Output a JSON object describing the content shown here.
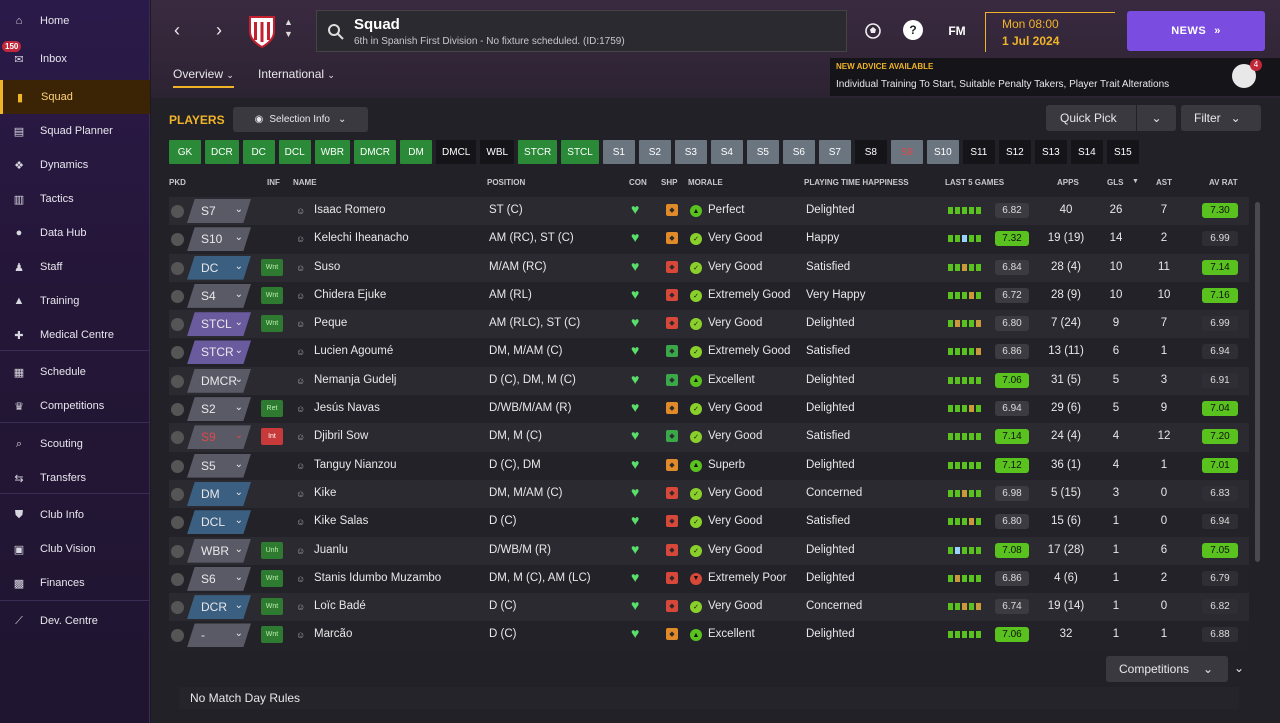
{
  "sidebar": {
    "inbox_badge": "150",
    "items": [
      {
        "label": "Home",
        "icon": "home-icon"
      },
      {
        "label": "Inbox",
        "icon": "inbox-icon"
      },
      {
        "label": "Squad",
        "icon": "squad-icon"
      },
      {
        "label": "Squad Planner",
        "icon": "clipboard-icon"
      },
      {
        "label": "Dynamics",
        "icon": "dynamics-icon"
      },
      {
        "label": "Tactics",
        "icon": "tactics-icon"
      },
      {
        "label": "Data Hub",
        "icon": "data-hub-icon"
      },
      {
        "label": "Staff",
        "icon": "staff-icon"
      },
      {
        "label": "Training",
        "icon": "training-icon"
      },
      {
        "label": "Medical Centre",
        "icon": "medical-icon"
      },
      {
        "label": "Schedule",
        "icon": "calendar-icon"
      },
      {
        "label": "Competitions",
        "icon": "trophy-icon"
      },
      {
        "label": "Scouting",
        "icon": "search-icon"
      },
      {
        "label": "Transfers",
        "icon": "transfers-icon"
      },
      {
        "label": "Club Info",
        "icon": "shield-icon"
      },
      {
        "label": "Club Vision",
        "icon": "briefcase-icon"
      },
      {
        "label": "Finances",
        "icon": "finances-icon"
      },
      {
        "label": "Dev. Centre",
        "icon": "dev-centre-icon"
      }
    ]
  },
  "header": {
    "title": "Squad",
    "subtitle": "6th in Spanish First Division - No fixture scheduled. (ID:1759)",
    "fm_label": "FM",
    "help_label": "?",
    "date_time": "Mon 08:00",
    "date_day": "1 Jul 2024",
    "news_label": "NEWS",
    "tabs": [
      {
        "label": "Overview"
      },
      {
        "label": "International"
      }
    ],
    "advice_title": "NEW ADVICE AVAILABLE",
    "advice_text": "Individual Training To Start, Suitable Penalty Takers, Player Trait Alterations",
    "advice_badge": "4"
  },
  "toolbar": {
    "players_label": "PLAYERS",
    "selection_info_label": "Selection Info",
    "quick_pick_label": "Quick Pick",
    "filter_label": "Filter"
  },
  "position_buttons": [
    {
      "label": "GK",
      "style": "green"
    },
    {
      "label": "DCR",
      "style": "green"
    },
    {
      "label": "DC",
      "style": "green"
    },
    {
      "label": "DCL",
      "style": "green"
    },
    {
      "label": "WBR",
      "style": "green"
    },
    {
      "label": "DMCR",
      "style": "green"
    },
    {
      "label": "DM",
      "style": "green"
    },
    {
      "label": "DMCL",
      "style": "black"
    },
    {
      "label": "WBL",
      "style": "black"
    },
    {
      "label": "STCR",
      "style": "green"
    },
    {
      "label": "STCL",
      "style": "green"
    },
    {
      "label": "S1",
      "style": "grey"
    },
    {
      "label": "S2",
      "style": "grey"
    },
    {
      "label": "S3",
      "style": "grey"
    },
    {
      "label": "S4",
      "style": "grey"
    },
    {
      "label": "S5",
      "style": "grey"
    },
    {
      "label": "S6",
      "style": "grey"
    },
    {
      "label": "S7",
      "style": "grey"
    },
    {
      "label": "S8",
      "style": "black"
    },
    {
      "label": "S9",
      "style": "grey red"
    },
    {
      "label": "S10",
      "style": "grey"
    },
    {
      "label": "S11",
      "style": "black"
    },
    {
      "label": "S12",
      "style": "black"
    },
    {
      "label": "S13",
      "style": "black"
    },
    {
      "label": "S14",
      "style": "black"
    },
    {
      "label": "S15",
      "style": "black"
    }
  ],
  "columns": {
    "pkd": "PKD",
    "inf": "INF",
    "name": "NAME",
    "position": "POSITION",
    "con": "CON",
    "shp": "SHP",
    "morale": "MORALE",
    "pth": "PLAYING TIME HAPPINESS",
    "last5": "LAST 5 GAMES",
    "apps": "APPS",
    "gls": "GLS",
    "ast": "AST",
    "avr": "AV RAT"
  },
  "colors": {
    "accent": "#f0b428",
    "news": "#7a4de0",
    "good": "#5ac21e",
    "chip_attack": "#5a5a66",
    "chip_def": "#3a5a7a",
    "chip_striker": "#6a5a9a"
  },
  "players": [
    {
      "slot": "S7",
      "chip": "grey",
      "inf": "",
      "name": "Isaac Romero",
      "position": "ST (C)",
      "shp": "amber",
      "morale_icon": "up",
      "morale": "Perfect",
      "pth": "Delighted",
      "form": "g g g g g",
      "last5": "6.82",
      "last5_hi": false,
      "apps": "40",
      "gls": "26",
      "ast": "7",
      "avr": "7.30",
      "avr_hi": true
    },
    {
      "slot": "S10",
      "chip": "grey",
      "inf": "",
      "name": "Kelechi Iheanacho",
      "position": "AM (RC), ST (C)",
      "shp": "amber",
      "morale_icon": "ok",
      "morale": "Very Good",
      "pth": "Happy",
      "form": "g g b g g",
      "last5": "7.32",
      "last5_hi": true,
      "apps": "19 (19)",
      "gls": "14",
      "ast": "2",
      "avr": "6.99",
      "avr_hi": false
    },
    {
      "slot": "DC",
      "chip": "def",
      "inf": "Wnt",
      "inf_style": "green",
      "name": "Suso",
      "position": "M/AM (RC)",
      "shp": "red",
      "morale_icon": "ok",
      "morale": "Very Good",
      "pth": "Satisfied",
      "form": "g g o g g",
      "last5": "6.84",
      "last5_hi": false,
      "apps": "28 (4)",
      "gls": "10",
      "ast": "11",
      "avr": "7.14",
      "avr_hi": true
    },
    {
      "slot": "S4",
      "chip": "grey",
      "inf": "Wnt",
      "inf_style": "green",
      "name": "Chidera Ejuke",
      "position": "AM (RL)",
      "shp": "red",
      "morale_icon": "ok",
      "morale": "Extremely Good",
      "pth": "Very Happy",
      "form": "g g g o g",
      "last5": "6.72",
      "last5_hi": false,
      "apps": "28 (9)",
      "gls": "10",
      "ast": "10",
      "avr": "7.16",
      "avr_hi": true
    },
    {
      "slot": "STCL",
      "chip": "striker",
      "inf": "Wnt",
      "inf_style": "green",
      "name": "Peque",
      "position": "AM (RLC), ST (C)",
      "shp": "red",
      "morale_icon": "ok",
      "morale": "Very Good",
      "pth": "Delighted",
      "form": "g o g g o",
      "last5": "6.80",
      "last5_hi": false,
      "apps": "7 (24)",
      "gls": "9",
      "ast": "7",
      "avr": "6.99",
      "avr_hi": false
    },
    {
      "slot": "STCR",
      "chip": "striker",
      "inf": "",
      "name": "Lucien Agoumé",
      "position": "DM, M/AM (C)",
      "shp": "green",
      "morale_icon": "ok",
      "morale": "Extremely Good",
      "pth": "Satisfied",
      "form": "g g g g o",
      "last5": "6.86",
      "last5_hi": false,
      "apps": "13 (11)",
      "gls": "6",
      "ast": "1",
      "avr": "6.94",
      "avr_hi": false
    },
    {
      "slot": "DMCR",
      "chip": "grey",
      "inf": "",
      "name": "Nemanja Gudelj",
      "position": "D (C), DM, M (C)",
      "shp": "green",
      "morale_icon": "up",
      "morale": "Excellent",
      "pth": "Delighted",
      "form": "g g g g g",
      "last5": "7.06",
      "last5_hi": true,
      "apps": "31 (5)",
      "gls": "5",
      "ast": "3",
      "avr": "6.91",
      "avr_hi": false
    },
    {
      "slot": "S2",
      "chip": "grey",
      "inf": "Ret",
      "inf_style": "green",
      "name": "Jesús Navas",
      "position": "D/WB/M/AM (R)",
      "shp": "amber",
      "morale_icon": "ok",
      "morale": "Very Good",
      "pth": "Delighted",
      "form": "g g g o g",
      "last5": "6.94",
      "last5_hi": false,
      "apps": "29 (6)",
      "gls": "5",
      "ast": "9",
      "avr": "7.04",
      "avr_hi": true
    },
    {
      "slot": "S9",
      "chip": "grey red",
      "inf": "Int",
      "inf_style": "red",
      "name": "Djibril Sow",
      "position": "DM, M (C)",
      "shp": "green",
      "morale_icon": "ok",
      "morale": "Very Good",
      "pth": "Satisfied",
      "form": "g g g g g",
      "last5": "7.14",
      "last5_hi": true,
      "apps": "24 (4)",
      "gls": "4",
      "ast": "12",
      "avr": "7.20",
      "avr_hi": true
    },
    {
      "slot": "S5",
      "chip": "grey",
      "inf": "",
      "name": "Tanguy Nianzou",
      "position": "D (C), DM",
      "shp": "amber",
      "morale_icon": "up",
      "morale": "Superb",
      "pth": "Delighted",
      "form": "g g g g g",
      "last5": "7.12",
      "last5_hi": true,
      "apps": "36 (1)",
      "gls": "4",
      "ast": "1",
      "avr": "7.01",
      "avr_hi": true
    },
    {
      "slot": "DM",
      "chip": "def",
      "inf": "",
      "name": "Kike",
      "position": "DM, M/AM (C)",
      "shp": "red",
      "morale_icon": "ok",
      "morale": "Very Good",
      "pth": "Concerned",
      "form": "g g o g g",
      "last5": "6.98",
      "last5_hi": false,
      "apps": "5 (15)",
      "gls": "3",
      "ast": "0",
      "avr": "6.83",
      "avr_hi": false
    },
    {
      "slot": "DCL",
      "chip": "def",
      "inf": "",
      "name": "Kike Salas",
      "position": "D (C)",
      "shp": "red",
      "morale_icon": "ok",
      "morale": "Very Good",
      "pth": "Satisfied",
      "form": "g g g o g",
      "last5": "6.80",
      "last5_hi": false,
      "apps": "15 (6)",
      "gls": "1",
      "ast": "0",
      "avr": "6.94",
      "avr_hi": false
    },
    {
      "slot": "WBR",
      "chip": "grey",
      "inf": "Unh",
      "inf_style": "green",
      "name": "Juanlu",
      "position": "D/WB/M (R)",
      "shp": "red",
      "morale_icon": "ok",
      "morale": "Very Good",
      "pth": "Delighted",
      "form": "g b g g g",
      "last5": "7.08",
      "last5_hi": true,
      "apps": "17 (28)",
      "gls": "1",
      "ast": "6",
      "avr": "7.05",
      "avr_hi": true
    },
    {
      "slot": "S6",
      "chip": "grey",
      "inf": "Wnt",
      "inf_style": "green",
      "name": "Stanis Idumbo Muzambo",
      "position": "DM, M (C), AM (LC)",
      "shp": "red",
      "morale_icon": "down",
      "morale": "Extremely Poor",
      "pth": "Delighted",
      "form": "g o g g g",
      "last5": "6.86",
      "last5_hi": false,
      "apps": "4 (6)",
      "gls": "1",
      "ast": "2",
      "avr": "6.79",
      "avr_hi": false
    },
    {
      "slot": "DCR",
      "chip": "def",
      "inf": "Wnt",
      "inf_style": "green",
      "name": "Loïc Badé",
      "position": "D (C)",
      "shp": "red",
      "morale_icon": "ok",
      "morale": "Very Good",
      "pth": "Concerned",
      "form": "g g o g o",
      "last5": "6.74",
      "last5_hi": false,
      "apps": "19 (14)",
      "gls": "1",
      "ast": "0",
      "avr": "6.82",
      "avr_hi": false
    },
    {
      "slot": "-",
      "chip": "grey",
      "inf": "Wnt",
      "inf_style": "green",
      "name": "Marcão",
      "position": "D (C)",
      "shp": "amber",
      "morale_icon": "up",
      "morale": "Excellent",
      "pth": "Delighted",
      "form": "g g g g g",
      "last5": "7.06",
      "last5_hi": true,
      "apps": "32",
      "gls": "1",
      "ast": "1",
      "avr": "6.88",
      "avr_hi": false
    }
  ],
  "footer": {
    "competitions_label": "Competitions",
    "match_rules": "No Match Day Rules"
  }
}
